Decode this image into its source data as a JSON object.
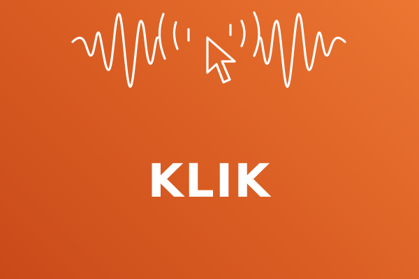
{
  "podcast": {
    "title": "KLIK"
  },
  "logo": {
    "icon": "sound-wave-cursor-icon"
  },
  "colors": {
    "background_start": "#C94A19",
    "background_end": "#EC7632",
    "foreground": "#FFFFFF"
  }
}
